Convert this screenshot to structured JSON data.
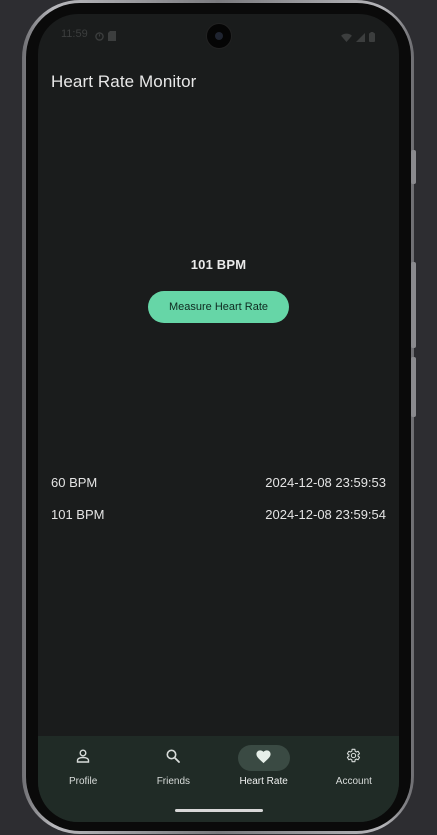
{
  "status_bar": {
    "time": "11:59",
    "left_icons": [
      "do-not-disturb-icon",
      "sd-card-icon"
    ],
    "right_icons": [
      "wifi-icon",
      "signal-icon",
      "battery-icon"
    ]
  },
  "app_bar": {
    "title": "Heart Rate Monitor"
  },
  "measurement": {
    "current_bpm": "101 BPM",
    "measure_label": "Measure Heart Rate"
  },
  "readings": [
    {
      "bpm": "60 BPM",
      "timestamp": "2024-12-08 23:59:53"
    },
    {
      "bpm": "101 BPM",
      "timestamp": "2024-12-08 23:59:54"
    }
  ],
  "bottom_nav": {
    "items": [
      {
        "label": "Profile",
        "icon": "person-icon",
        "active": false
      },
      {
        "label": "Friends",
        "icon": "search-icon",
        "active": false
      },
      {
        "label": "Heart Rate",
        "icon": "heart-icon",
        "active": true
      },
      {
        "label": "Account",
        "icon": "gear-icon",
        "active": false
      }
    ]
  },
  "colors": {
    "screen_background": "#1a1c1c",
    "accent": "#66d6a7",
    "nav_background": "#202b26",
    "nav_active_pill": "#3a4a43"
  }
}
